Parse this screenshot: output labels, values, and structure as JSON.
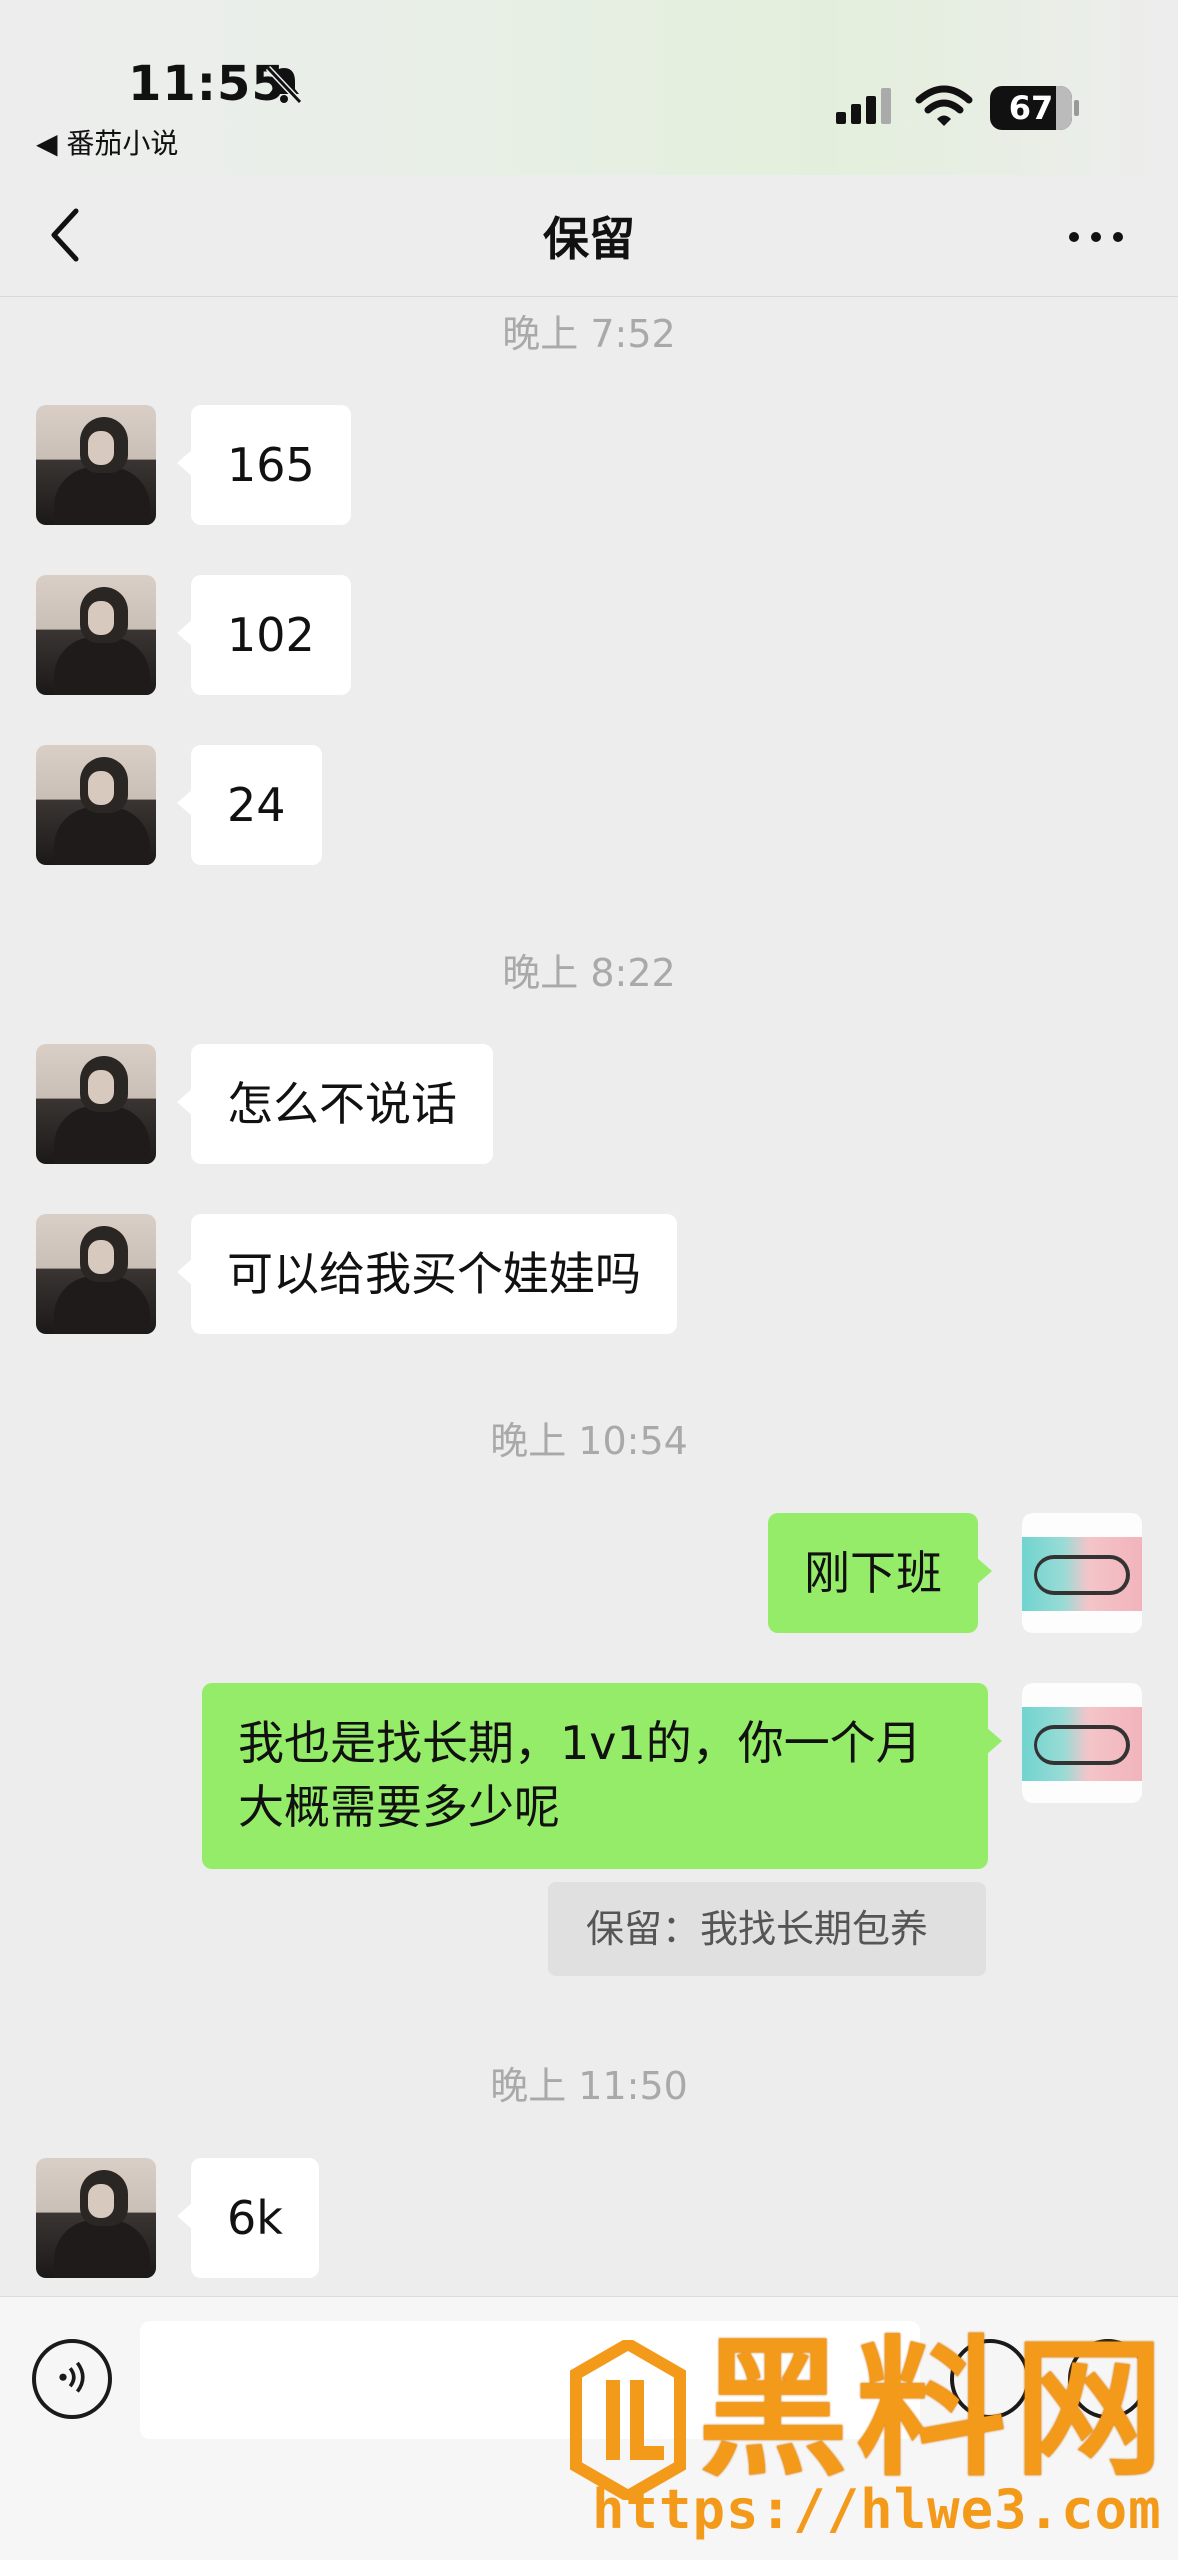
{
  "status_bar": {
    "time": "11:55",
    "back_app": "◀ 番茄小说",
    "battery": "67"
  },
  "nav": {
    "title": "保留"
  },
  "messages": {
    "ts1": "晚上 7:52",
    "m1": "165",
    "m2": "102",
    "m3": "24",
    "ts2": "晚上 8:22",
    "m4": "怎么不说话",
    "m5": "可以给我买个娃娃吗",
    "ts3": "晚上 10:54",
    "m6": "刚下班",
    "m7_line1": "我也是找长期，1v1的，你一个月",
    "m7_line2": "大概需要多少呢",
    "quote": "保留：我找长期包养",
    "ts4": "晚上 11:50",
    "m8": "6k"
  },
  "input": {
    "placeholder": ""
  },
  "watermark": {
    "text": "黑料网",
    "url": "https://hlwe3.com"
  },
  "colors": {
    "background": "#ededed",
    "outgoing_bubble": "#95ec69",
    "incoming_bubble": "#ffffff",
    "watermark": "#f39a1b"
  },
  "icons": [
    "chevron-left-icon",
    "more-icon",
    "mute-bell-icon",
    "signal-icon",
    "wifi-icon",
    "battery-icon",
    "voice-icon",
    "emoji-icon",
    "plus-icon"
  ]
}
